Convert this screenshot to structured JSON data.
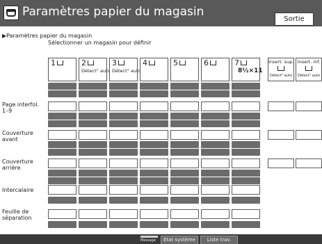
{
  "header": {
    "title": "Paramètres papier du magasin",
    "exit_label": "Sortie"
  },
  "breadcrumb": "▶Paramètres papier du magasin",
  "instruction": "Sélectionner un magasin pour définir",
  "trays": [
    {
      "label": "1",
      "sub": ""
    },
    {
      "label": "2",
      "sub": "Détect° auto"
    },
    {
      "label": "3",
      "sub": "Détect° auto"
    },
    {
      "label": "4",
      "sub": ""
    },
    {
      "label": "5",
      "sub": ""
    },
    {
      "label": "6",
      "sub": ""
    },
    {
      "label": "7",
      "sub": "8½×11"
    },
    {
      "label": "Insert. sup.",
      "sub": "Détect° auto"
    },
    {
      "label": "Insert. inf.",
      "sub": "Détect° auto"
    }
  ],
  "rows": [
    {
      "label": "Page interfol. 1–9"
    },
    {
      "label": "Couverture avant"
    },
    {
      "label": "Couverture arrière"
    },
    {
      "label": "Intercalaire"
    },
    {
      "label": "Feuille de séparation"
    }
  ],
  "footer": {
    "message_label": "Message",
    "tabs": [
      {
        "label": "Etat système"
      },
      {
        "label": "Liste trav."
      }
    ]
  }
}
